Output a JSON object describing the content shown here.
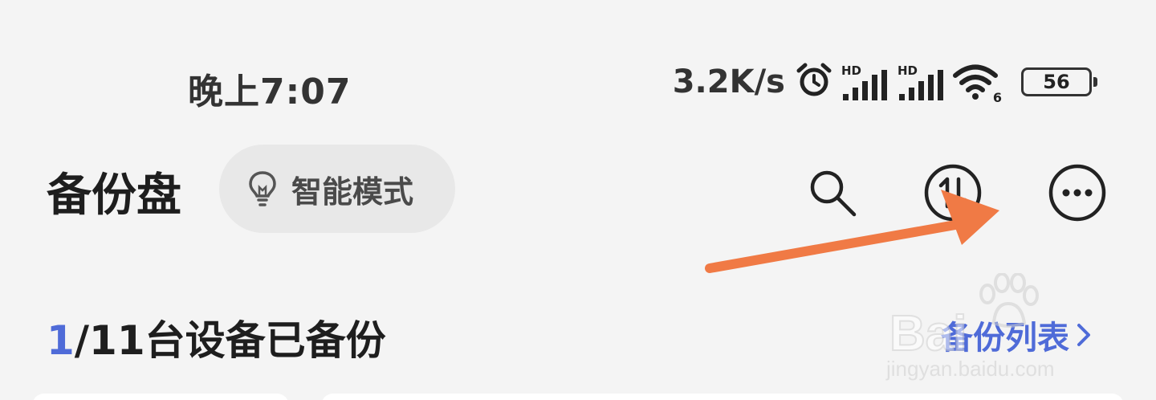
{
  "status_bar": {
    "time": "晚上7:07",
    "net_speed": "3.2K/s",
    "signal_label": "HD",
    "wifi_label": "6",
    "battery": "56",
    "icons": [
      "alarm-icon",
      "signal-icon",
      "signal-icon",
      "wifi-icon",
      "battery-icon"
    ]
  },
  "header": {
    "title": "备份盘",
    "mode_chip": {
      "label": "智能模式",
      "icon": "lightbulb-icon"
    },
    "actions": [
      "search-icon",
      "transfer-icon",
      "more-icon"
    ]
  },
  "backup": {
    "count_done": "1",
    "count_rest": "/11台设备已备份",
    "list_link": "备份列表",
    "list_icon": "chevron-right-icon"
  },
  "watermark": {
    "brand": "Bai",
    "sub": "jingyan.baidu.com"
  },
  "colors": {
    "accent": "#4f6bd8",
    "annotation": "#f07a45",
    "background": "#f4f4f4"
  }
}
